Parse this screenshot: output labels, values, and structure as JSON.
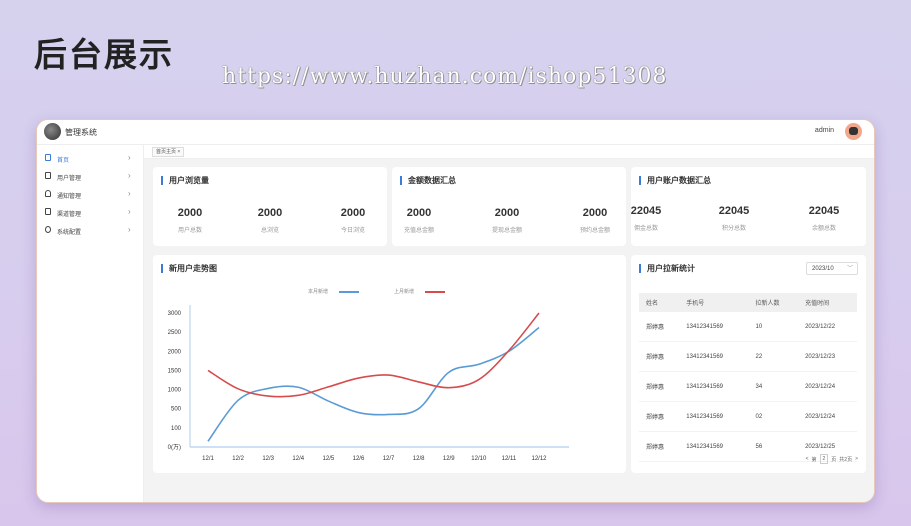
{
  "banner": {
    "title": "后台展示",
    "watermark": "https://www.huzhan.com/ishop51308"
  },
  "header": {
    "app_title": "管理系统",
    "user_name": "admin"
  },
  "sidebar": {
    "items": [
      {
        "label": "首页",
        "icon": "home-icon",
        "active": true
      },
      {
        "label": "用户管理",
        "icon": "user-icon"
      },
      {
        "label": "通知管理",
        "icon": "bell-icon"
      },
      {
        "label": "渠道管理",
        "icon": "channel-icon"
      },
      {
        "label": "系统配置",
        "icon": "gear-icon"
      }
    ]
  },
  "tabs": [
    {
      "label": "首页主页 ×"
    }
  ],
  "cards": [
    {
      "title": "用户浏览量",
      "stats": [
        {
          "value": "2000",
          "label": "用户总数"
        },
        {
          "value": "2000",
          "label": "总浏览"
        },
        {
          "value": "2000",
          "label": "今日浏览"
        }
      ]
    },
    {
      "title": "金额数据汇总",
      "stats": [
        {
          "value": "2000",
          "label": "充值总金额"
        },
        {
          "value": "2000",
          "label": "提现总金额"
        },
        {
          "value": "2000",
          "label": "预约总金额"
        }
      ]
    },
    {
      "title": "用户账户数据汇总",
      "stats": [
        {
          "value": "22045",
          "label": "佣金总数"
        },
        {
          "value": "22045",
          "label": "积分总数"
        },
        {
          "value": "22045",
          "label": "余额总数"
        }
      ]
    }
  ],
  "trend": {
    "title": "新用户走势图"
  },
  "chart_data": {
    "type": "line",
    "categories": [
      "12/1",
      "12/2",
      "12/3",
      "12/4",
      "12/5",
      "12/6",
      "12/7",
      "12/8",
      "12/9",
      "12/10",
      "12/11",
      "12/12"
    ],
    "y_ticks": [
      "3000",
      "2500",
      "2000",
      "1500",
      "1000",
      "500",
      "100",
      "0(万)"
    ],
    "series": [
      {
        "name": "本月新增",
        "color": "#5b9bd5",
        "values": [
          30,
          720,
          1030,
          1060,
          700,
          420,
          380,
          500,
          1450,
          1660,
          2000,
          2620
        ]
      },
      {
        "name": "上月新增",
        "color": "#d64c4c",
        "values": [
          1500,
          1020,
          830,
          850,
          1070,
          1300,
          1380,
          1200,
          1050,
          1260,
          2020,
          3000
        ]
      }
    ]
  },
  "invite": {
    "title": "用户拉新统计",
    "period": "2023/10",
    "columns": [
      "姓名",
      "手机号",
      "拉新人数",
      "充值时间"
    ],
    "rows": [
      [
        "郑婷惠",
        "13412341569",
        "10",
        "2023/12/22"
      ],
      [
        "郑婷惠",
        "13412341569",
        "22",
        "2023/12/23"
      ],
      [
        "郑婷惠",
        "13412341569",
        "34",
        "2023/12/24"
      ],
      [
        "郑婷惠",
        "13412341569",
        "02",
        "2023/12/24"
      ],
      [
        "郑婷惠",
        "13412341569",
        "56",
        "2023/12/25"
      ]
    ],
    "pager": {
      "prev": "<",
      "page_prefix": "第",
      "page": "2",
      "page_suffix": "页",
      "total": "共2页",
      "next": ">"
    }
  }
}
